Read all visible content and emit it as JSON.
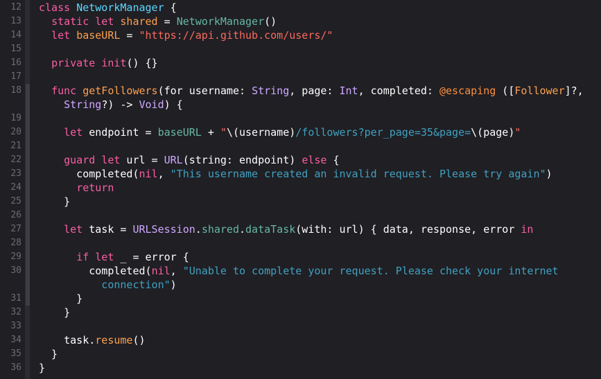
{
  "editor": {
    "language": "Swift",
    "theme": "dark",
    "colors": {
      "background": "#1f1f24",
      "keyword": "#fc5fa3",
      "string": "#fc6a5d",
      "type": "#d0a8ff",
      "class_name": "#5dd8ff",
      "function": "#67b7a4",
      "url_link": "#41a1c0",
      "attribute": "#fd8f3f",
      "line_number": "#6c6c72"
    }
  },
  "lines": [
    {
      "num": "12",
      "parts": [
        [
          "kw",
          "class"
        ],
        [
          "def",
          " "
        ],
        [
          "cls",
          "NetworkManager"
        ],
        [
          "def",
          " {"
        ]
      ]
    },
    {
      "num": "13",
      "parts": [
        [
          "def",
          "  "
        ],
        [
          "kw",
          "static"
        ],
        [
          "def",
          " "
        ],
        [
          "kw",
          "let"
        ],
        [
          "def",
          " "
        ],
        [
          "prop",
          "shared"
        ],
        [
          "def",
          " = "
        ],
        [
          "fn",
          "NetworkManager"
        ],
        [
          "def",
          "()"
        ]
      ]
    },
    {
      "num": "14",
      "parts": [
        [
          "def",
          "  "
        ],
        [
          "kw",
          "let"
        ],
        [
          "def",
          " "
        ],
        [
          "prop",
          "baseURL"
        ],
        [
          "def",
          " = "
        ],
        [
          "str",
          "\"https://api.github.com/users/\""
        ]
      ]
    },
    {
      "num": "15",
      "parts": []
    },
    {
      "num": "16",
      "parts": [
        [
          "def",
          "  "
        ],
        [
          "kw",
          "private"
        ],
        [
          "def",
          " "
        ],
        [
          "kw",
          "init"
        ],
        [
          "def",
          "() {}"
        ]
      ]
    },
    {
      "num": "17",
      "parts": []
    },
    {
      "num": "18",
      "parts": [
        [
          "def",
          "  "
        ],
        [
          "kw",
          "func"
        ],
        [
          "def",
          " "
        ],
        [
          "prop",
          "getFollowers"
        ],
        [
          "def",
          "(for username: "
        ],
        [
          "ty",
          "String"
        ],
        [
          "def",
          ", page: "
        ],
        [
          "ty",
          "Int"
        ],
        [
          "def",
          ", completed: "
        ],
        [
          "attr",
          "@escaping"
        ],
        [
          "def",
          " (["
        ],
        [
          "prop",
          "Follower"
        ],
        [
          "def",
          "]?,"
        ]
      ]
    },
    {
      "num": "",
      "parts": [
        [
          "def",
          "    "
        ],
        [
          "ty",
          "String"
        ],
        [
          "def",
          "?) -> "
        ],
        [
          "ty",
          "Void"
        ],
        [
          "def",
          ") {"
        ]
      ]
    },
    {
      "num": "19",
      "parts": []
    },
    {
      "num": "20",
      "parts": [
        [
          "def",
          "    "
        ],
        [
          "kw",
          "let"
        ],
        [
          "def",
          " endpoint = "
        ],
        [
          "fn",
          "baseURL"
        ],
        [
          "def",
          " + "
        ],
        [
          "str",
          "\""
        ],
        [
          "def",
          "\\(username)"
        ],
        [
          "path",
          "/followers?per_page=35&page="
        ],
        [
          "def",
          "\\(page)"
        ],
        [
          "str",
          "\""
        ]
      ]
    },
    {
      "num": "21",
      "parts": []
    },
    {
      "num": "22",
      "parts": [
        [
          "def",
          "    "
        ],
        [
          "kw",
          "guard"
        ],
        [
          "def",
          " "
        ],
        [
          "kw",
          "let"
        ],
        [
          "def",
          " url = "
        ],
        [
          "ty",
          "URL"
        ],
        [
          "def",
          "(string: endpoint) "
        ],
        [
          "kw",
          "else"
        ],
        [
          "def",
          " {"
        ]
      ]
    },
    {
      "num": "23",
      "parts": [
        [
          "def",
          "      completed("
        ],
        [
          "kw",
          "nil"
        ],
        [
          "def",
          ", "
        ],
        [
          "path",
          "\"This username created an invalid request. Please try again\""
        ],
        [
          "def",
          ")"
        ]
      ]
    },
    {
      "num": "24",
      "parts": [
        [
          "def",
          "      "
        ],
        [
          "kw",
          "return"
        ]
      ]
    },
    {
      "num": "25",
      "parts": [
        [
          "def",
          "    }"
        ]
      ]
    },
    {
      "num": "26",
      "parts": []
    },
    {
      "num": "27",
      "parts": [
        [
          "def",
          "    "
        ],
        [
          "kw",
          "let"
        ],
        [
          "def",
          " task = "
        ],
        [
          "ty",
          "URLSession"
        ],
        [
          "def",
          "."
        ],
        [
          "fn",
          "shared"
        ],
        [
          "def",
          "."
        ],
        [
          "fn",
          "dataTask"
        ],
        [
          "def",
          "(with: url) { data, response, error "
        ],
        [
          "kw",
          "in"
        ]
      ]
    },
    {
      "num": "28",
      "parts": []
    },
    {
      "num": "29",
      "parts": [
        [
          "def",
          "      "
        ],
        [
          "kw",
          "if"
        ],
        [
          "def",
          " "
        ],
        [
          "kw",
          "let"
        ],
        [
          "def",
          " _ = error {"
        ]
      ]
    },
    {
      "num": "30",
      "parts": [
        [
          "def",
          "        completed("
        ],
        [
          "kw",
          "nil"
        ],
        [
          "def",
          ", "
        ],
        [
          "path",
          "\"Unable to complete your request. Please check your internet"
        ]
      ]
    },
    {
      "num": "",
      "parts": [
        [
          "path",
          "          connection\""
        ],
        [
          "def",
          ")"
        ]
      ]
    },
    {
      "num": "31",
      "parts": [
        [
          "def",
          "      }"
        ]
      ]
    },
    {
      "num": "32",
      "parts": [
        [
          "def",
          "    }"
        ]
      ]
    },
    {
      "num": "33",
      "parts": []
    },
    {
      "num": "34",
      "parts": [
        [
          "def",
          "    task."
        ],
        [
          "prop",
          "resume"
        ],
        [
          "def",
          "()"
        ]
      ]
    },
    {
      "num": "35",
      "parts": [
        [
          "def",
          "  }"
        ]
      ]
    },
    {
      "num": "36",
      "parts": [
        [
          "def",
          "}"
        ]
      ]
    }
  ]
}
